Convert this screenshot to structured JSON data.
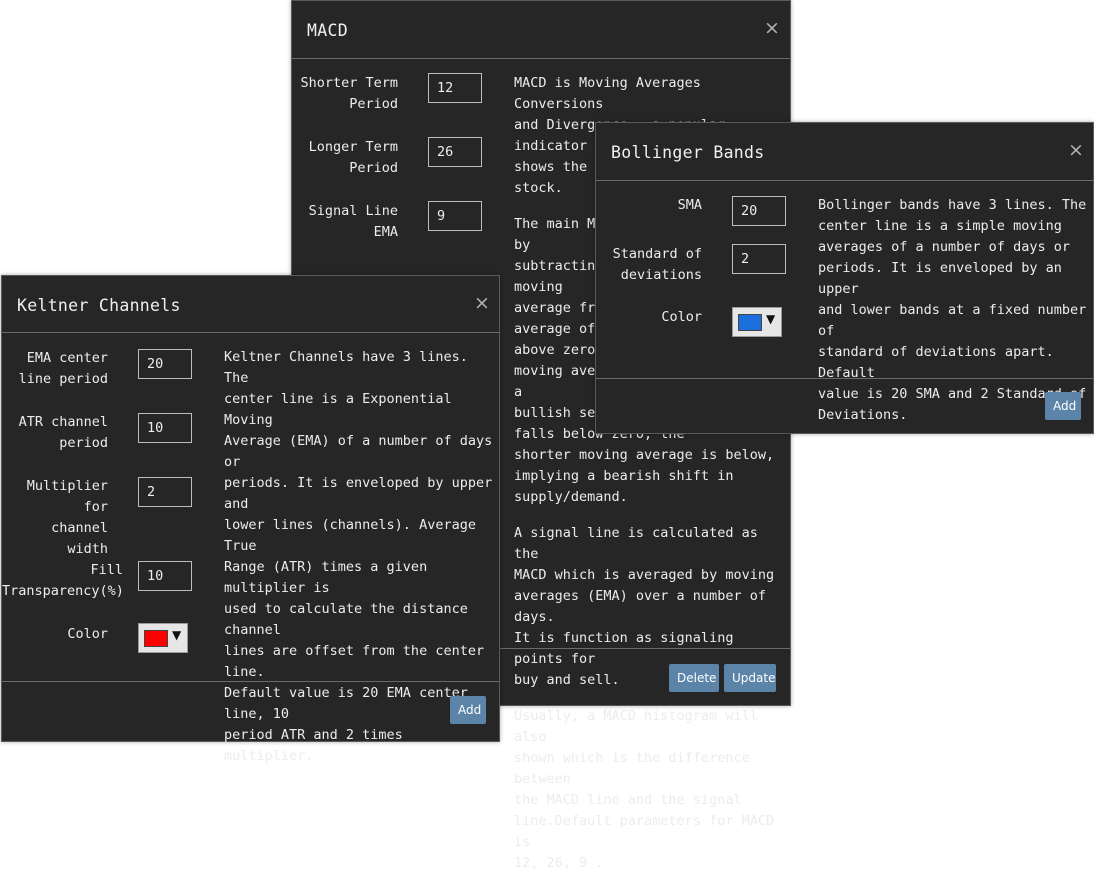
{
  "macd": {
    "title": "MACD",
    "close": "×",
    "fields": [
      {
        "label": "Shorter Term\nPeriod",
        "value": "12"
      },
      {
        "label": "Longer Term\nPeriod",
        "value": "26"
      },
      {
        "label": "Signal Line\nEMA",
        "value": "9"
      }
    ],
    "description": [
      "MACD is Moving Averages Conversions\nand Divergence - a popular indicator\nshows the momentum trend of a stock.",
      "The main MACD line is calculated by\nsubtracting a longer period moving\naverage from a shorter moving\naverage of its price. If it is\nabove zero, the shorter period\nmoving average is above, implying a\nbullish sentiment and when it\nfalls below zero, the\nshorter moving average is below,\nimplying a bearish shift in\nsupply/demand.",
      "A signal line is calculated as the\nMACD which is averaged by moving\naverages (EMA) over a number of days.\nIt is function as signaling points for\nbuy and sell.",
      "Usually, a MACD histogram will also\nshown which is the difference between\nthe MACD line and the signal\nline.Default parameters for MACD is\n12, 26, 9 ."
    ],
    "delete_label": "Delete",
    "update_label": "Update"
  },
  "bollinger": {
    "title": "Bollinger Bands",
    "close": "×",
    "fields": [
      {
        "label": "SMA",
        "value": "20"
      },
      {
        "label": "Standard of\ndeviations",
        "value": "2"
      }
    ],
    "color_label": "Color",
    "color_value": "#1a6fdc",
    "description": "Bollinger bands have 3 lines. The\ncenter line is a simple moving\naverages of a number of days or\nperiods. It is enveloped by an upper\nand lower bands at a fixed number of\nstandard of deviations apart. Default\nvalue is 20 SMA and 2 Standard of\nDeviations.",
    "add_label": "Add"
  },
  "keltner": {
    "title": "Keltner Channels",
    "close": "×",
    "fields": [
      {
        "label": "EMA center\nline period",
        "value": "20"
      },
      {
        "label": "ATR channel\nperiod",
        "value": "10"
      },
      {
        "label": "Multiplier for\nchannel\nwidth",
        "value": "2"
      },
      {
        "label": "Fill\nTransparency(%)",
        "value": "10"
      }
    ],
    "color_label": "Color",
    "color_value": "#ff0000",
    "description": "Keltner Channels have 3 lines. The\ncenter line is a Exponential Moving\nAverage (EMA) of a number of days or\nperiods. It is enveloped by upper and\nlower lines (channels). Average True\nRange (ATR) times a given multiplier is\nused to calculate the distance channel\nlines are offset from the center line.\nDefault value is 20 EMA center line, 10\nperiod ATR and 2 times multiplier.",
    "add_label": "Add"
  },
  "icons": {
    "close": "close-icon",
    "dropdown": "triangle-down-icon"
  }
}
